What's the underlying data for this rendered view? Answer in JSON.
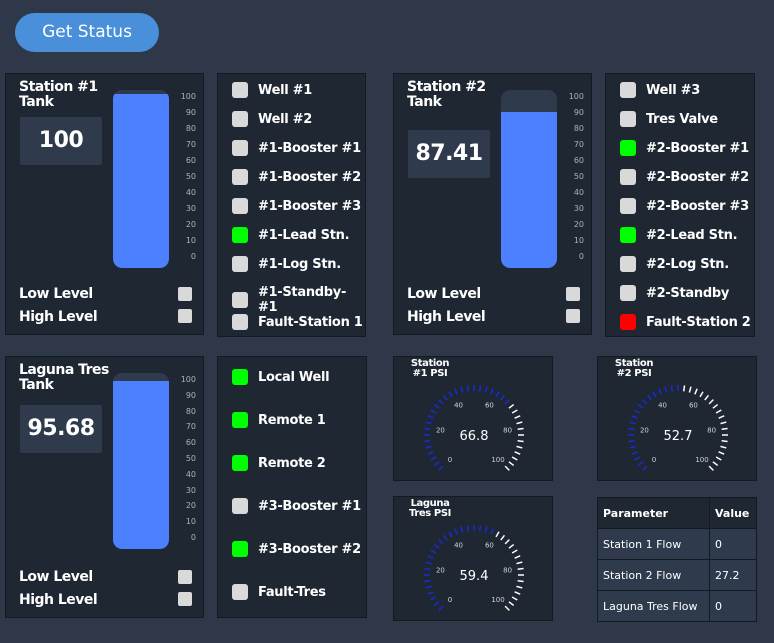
{
  "header": {
    "get_status_label": "Get Status"
  },
  "station1": {
    "title": "Station #1 Tank",
    "value": "100",
    "level_fraction": 0.98,
    "low_label": "Low Level",
    "high_label": "High Level",
    "checks": [
      {
        "label": "Well #1",
        "color": "#d9d9d9"
      },
      {
        "label": "Well #2",
        "color": "#d9d9d9"
      },
      {
        "label": "#1-Booster #1",
        "color": "#d9d9d9"
      },
      {
        "label": "#1-Booster #2",
        "color": "#d9d9d9"
      },
      {
        "label": "#1-Booster #3",
        "color": "#d9d9d9"
      },
      {
        "label": "#1-Lead Stn.",
        "color": "#00ff00"
      },
      {
        "label": "#1-Log Stn.",
        "color": "#d9d9d9"
      },
      {
        "label": "#1-Standby-#1",
        "color": "#d9d9d9"
      },
      {
        "label": "Fault-Station 1",
        "color": "#d9d9d9"
      }
    ]
  },
  "station2": {
    "title": "Station #2 Tank",
    "value": "87.41",
    "level_fraction": 0.8741,
    "low_label": "Low Level",
    "high_label": "High Level",
    "checks": [
      {
        "label": "Well #3",
        "color": "#d9d9d9"
      },
      {
        "label": "Tres Valve",
        "color": "#d9d9d9"
      },
      {
        "label": "#2-Booster #1",
        "color": "#00ff00"
      },
      {
        "label": "#2-Booster #2",
        "color": "#d9d9d9"
      },
      {
        "label": "#2-Booster #3",
        "color": "#d9d9d9"
      },
      {
        "label": "#2-Lead Stn.",
        "color": "#00ff00"
      },
      {
        "label": "#2-Log Stn.",
        "color": "#d9d9d9"
      },
      {
        "label": "#2-Standby",
        "color": "#d9d9d9"
      },
      {
        "label": "Fault-Station 2",
        "color": "#ff0000"
      }
    ]
  },
  "laguna": {
    "title": "Laguna Tres Tank",
    "value": "95.68",
    "level_fraction": 0.9568,
    "low_label": "Low Level",
    "high_label": "High Level",
    "checks": [
      {
        "label": "Local Well",
        "color": "#00ff00"
      },
      {
        "label": "Remote 1",
        "color": "#00ff00"
      },
      {
        "label": "Remote 2",
        "color": "#00ff00"
      },
      {
        "label": "#3-Booster #1",
        "color": "#d9d9d9"
      },
      {
        "label": "#3-Booster #2",
        "color": "#00ff00"
      },
      {
        "label": "Fault-Tres",
        "color": "#d9d9d9"
      }
    ]
  },
  "tank_scale": [
    "100",
    "90",
    "80",
    "70",
    "60",
    "50",
    "40",
    "30",
    "20",
    "10",
    "0"
  ],
  "gauges": [
    {
      "title": "Station #1 PSI",
      "value": "66.8",
      "num": 66.8
    },
    {
      "title": "Station #2 PSI",
      "value": "52.7",
      "num": 52.7
    },
    {
      "title": "Laguna Tres PSI",
      "value": "59.4",
      "num": 59.4
    }
  ],
  "gauge_scale": [
    "0",
    "20",
    "40",
    "60",
    "80",
    "100"
  ],
  "params": {
    "headers": [
      "Parameter",
      "Value"
    ],
    "rows": [
      [
        "Station 1 Flow",
        "0"
      ],
      [
        "Station 2 Flow",
        "27.2"
      ],
      [
        "Laguna Tres Flow",
        "0"
      ]
    ]
  },
  "colors": {
    "accent": "#4a8fd9",
    "tank_fill": "#4c80ff",
    "on": "#00ff00",
    "fault": "#ff0000",
    "gauge_active": "#1a2bd6"
  }
}
